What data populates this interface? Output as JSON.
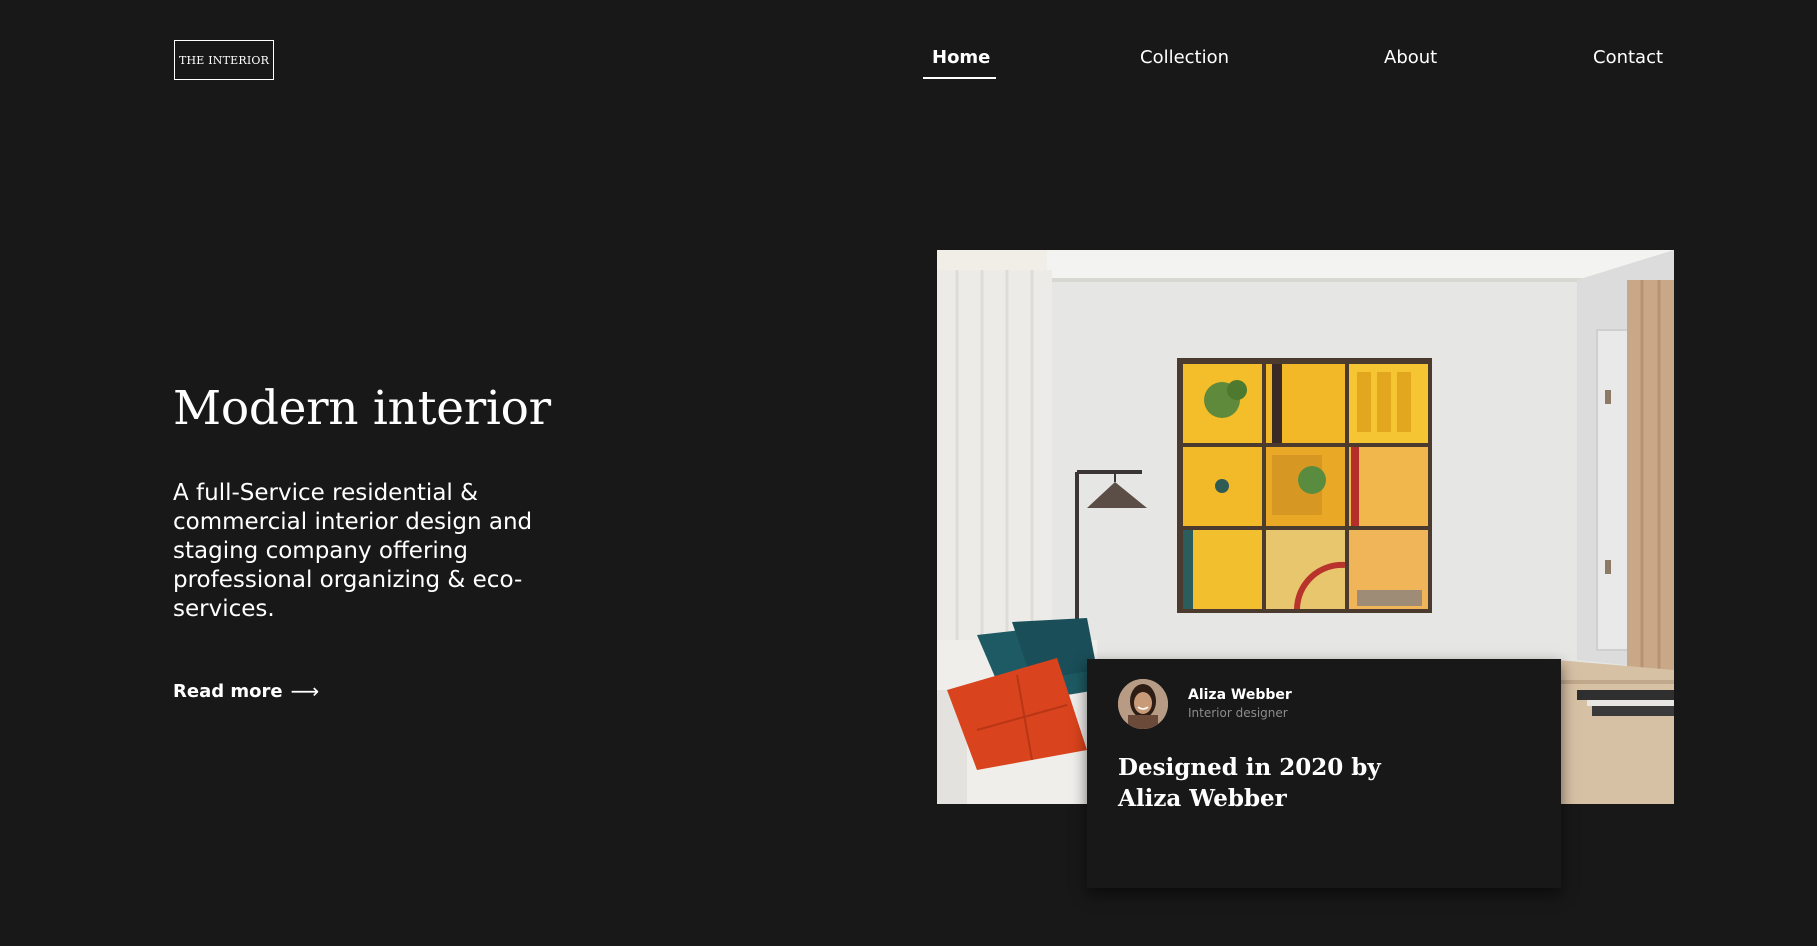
{
  "header": {
    "logo_text": "THE INTERIOR",
    "nav": [
      {
        "label": "Home",
        "active": true
      },
      {
        "label": "Collection",
        "active": false
      },
      {
        "label": "About",
        "active": false
      },
      {
        "label": "Contact",
        "active": false
      }
    ]
  },
  "hero": {
    "title": "Modern interior",
    "description": "A full-Service residential & commercial interior design and staging company offering professional organizing & eco-services.",
    "read_more_label": "Read more",
    "read_more_icon": "arrow-right-icon"
  },
  "card": {
    "author_name": "Aliza Webber",
    "author_role": "Interior designer",
    "title": "Designed in 2020 by Aliza Webber"
  },
  "colors": {
    "background": "#181818",
    "text": "#ffffff",
    "muted": "#8c8c8c"
  }
}
